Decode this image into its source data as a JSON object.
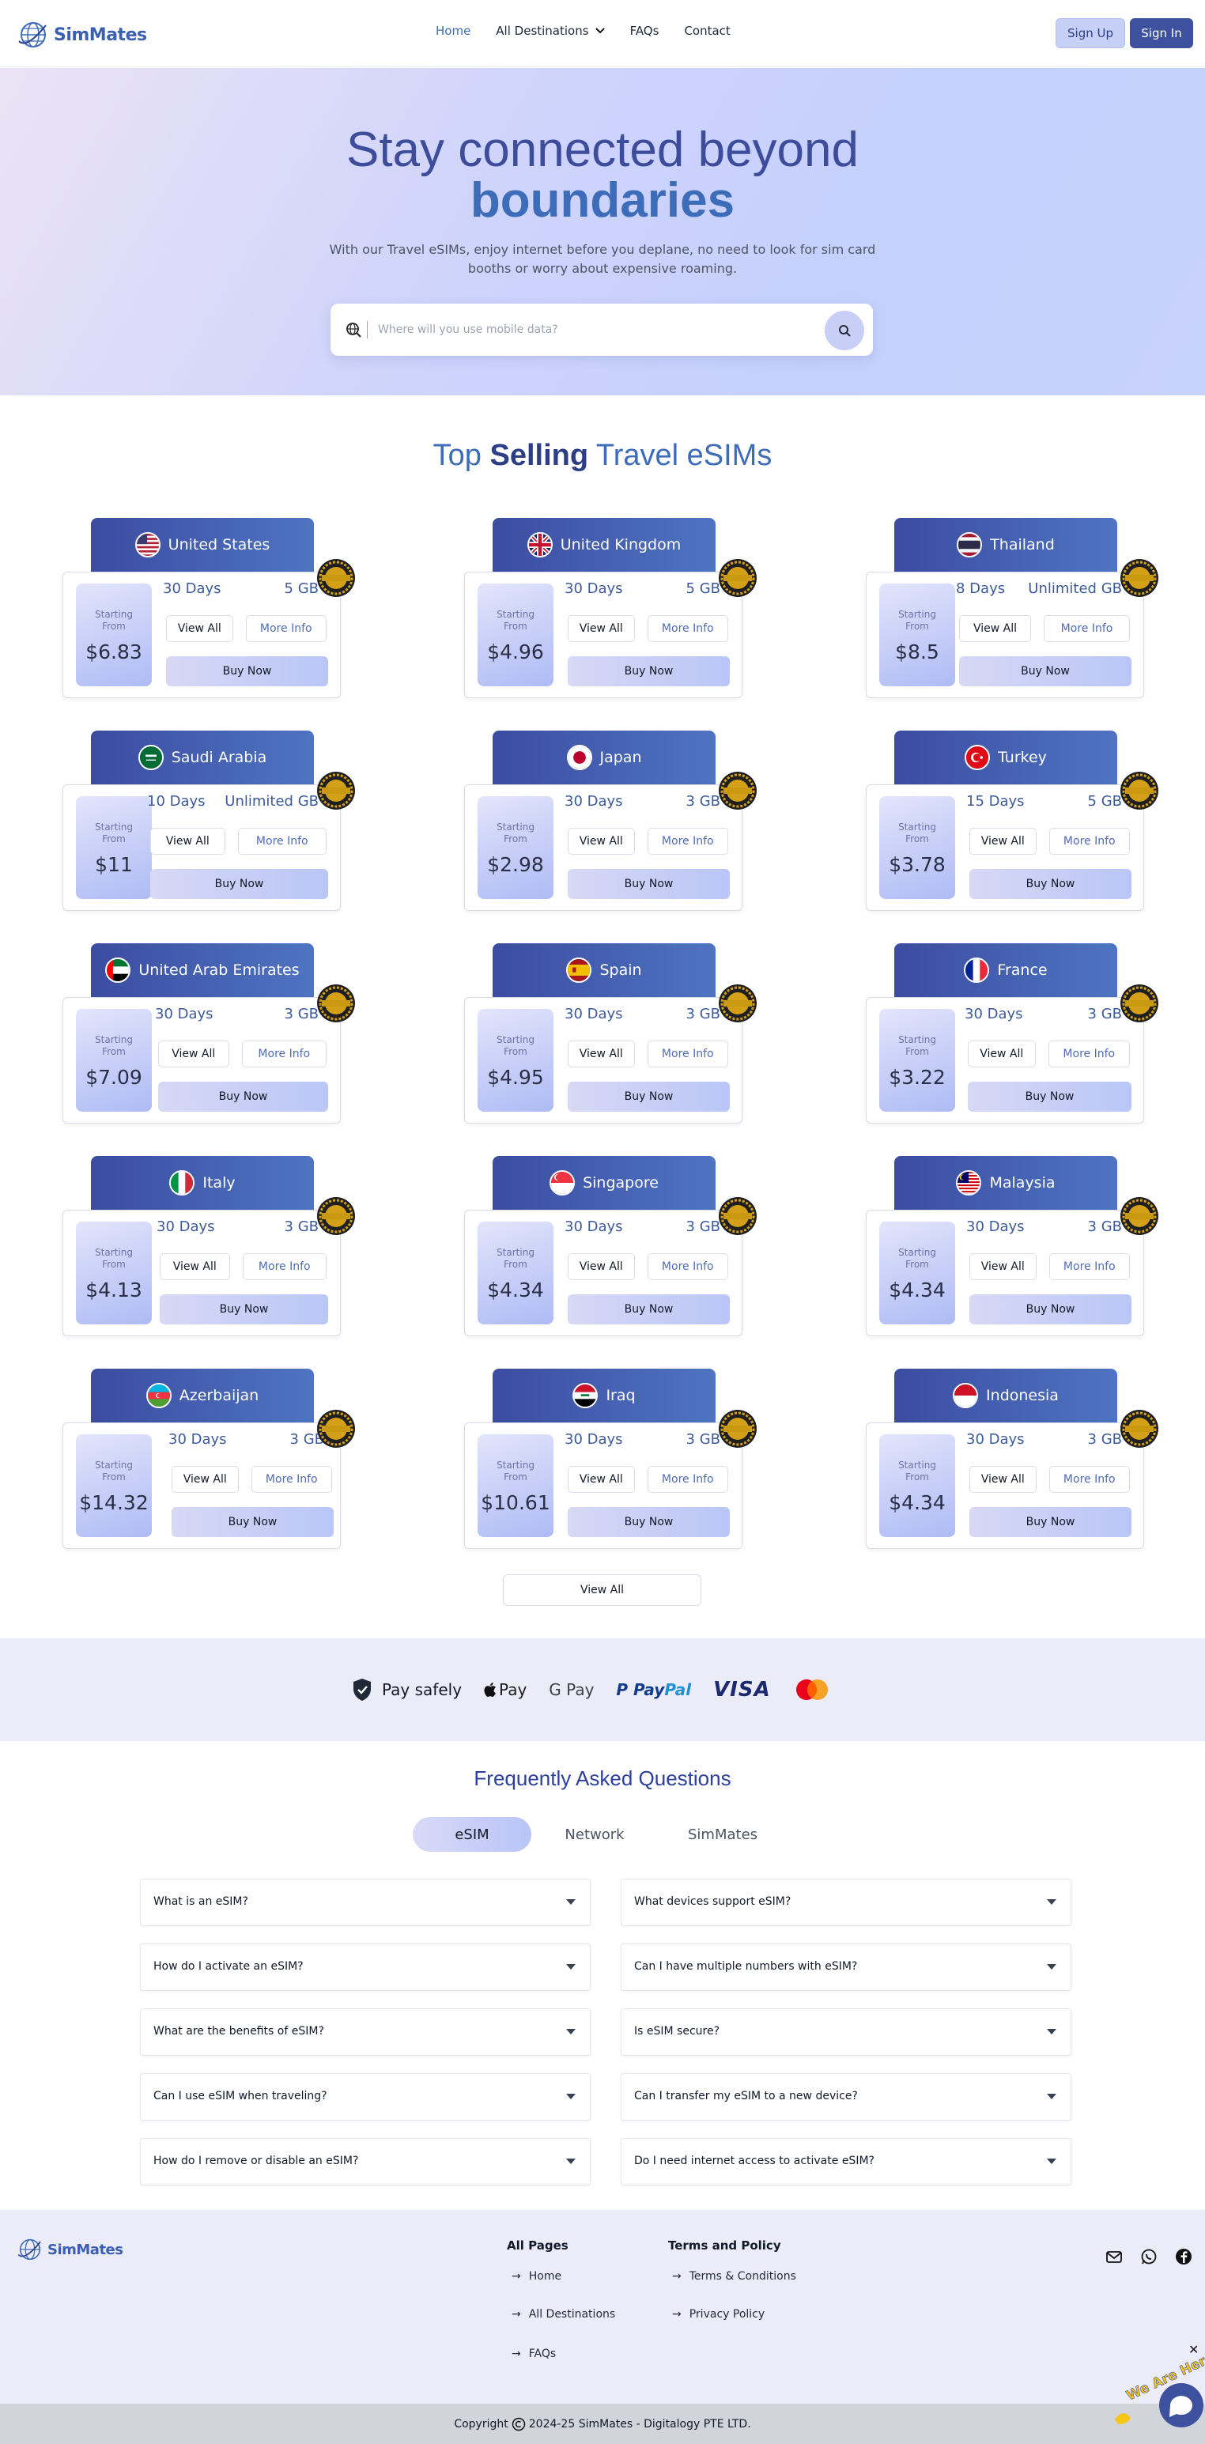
{
  "nav": {
    "logo": "SimMates",
    "links": [
      "Home",
      "All Destinations",
      "FAQs",
      "Contact"
    ],
    "signup": "Sign Up",
    "signin": "Sign In"
  },
  "hero": {
    "title_line1": "Stay connected beyond",
    "title_line2": "boundaries",
    "subtitle": "With our Travel eSIMs, enjoy internet before you deplane, no need to look for sim card booths or worry about expensive roaming.",
    "search_placeholder": "Where will you use mobile data?"
  },
  "section": {
    "title_a": "Top ",
    "title_b": "Selling",
    "title_c": " Travel eSIMs"
  },
  "card_labels": {
    "starting": "Starting",
    "from": "From",
    "view_all": "View All",
    "more_info": "More Info",
    "buy_now": "Buy Now"
  },
  "cards": [
    {
      "country": "United States",
      "price": "$6.83",
      "days": "30 Days",
      "data": "5 GB"
    },
    {
      "country": "United Kingdom",
      "price": "$4.96",
      "days": "30 Days",
      "data": "5 GB"
    },
    {
      "country": "Thailand",
      "price": "$8.5",
      "days": "8 Days",
      "data": "Unlimited GB"
    },
    {
      "country": "Saudi Arabia",
      "price": "$11",
      "days": "10 Days",
      "data": "Unlimited GB"
    },
    {
      "country": "Japan",
      "price": "$2.98",
      "days": "30 Days",
      "data": "3 GB"
    },
    {
      "country": "Turkey",
      "price": "$3.78",
      "days": "15 Days",
      "data": "5 GB"
    },
    {
      "country": "United Arab Emirates",
      "price": "$7.09",
      "days": "30 Days",
      "data": "3 GB"
    },
    {
      "country": "Spain",
      "price": "$4.95",
      "days": "30 Days",
      "data": "3 GB"
    },
    {
      "country": "France",
      "price": "$3.22",
      "days": "30 Days",
      "data": "3 GB"
    },
    {
      "country": "Italy",
      "price": "$4.13",
      "days": "30 Days",
      "data": "3 GB"
    },
    {
      "country": "Singapore",
      "price": "$4.34",
      "days": "30 Days",
      "data": "3 GB"
    },
    {
      "country": "Malaysia",
      "price": "$4.34",
      "days": "30 Days",
      "data": "3 GB"
    },
    {
      "country": "Azerbaijan",
      "price": "$14.32",
      "days": "30 Days",
      "data": "3 GB"
    },
    {
      "country": "Iraq",
      "price": "$10.61",
      "days": "30 Days",
      "data": "3 GB"
    },
    {
      "country": "Indonesia",
      "price": "$4.34",
      "days": "30 Days",
      "data": "3 GB"
    }
  ],
  "view_all": "View All",
  "payments": {
    "label": "Pay safely",
    "apple": "Pay",
    "google": "G Pay",
    "paypal_a": "Pay",
    "paypal_b": "Pal",
    "visa": "VISA"
  },
  "faq": {
    "title": "Frequently Asked Questions",
    "tabs": [
      "eSIM",
      "Network",
      "SimMates"
    ],
    "questions": [
      "What is an eSIM?",
      "What devices support eSIM?",
      "How do I activate an eSIM?",
      "Can I have multiple numbers with eSIM?",
      "What are the benefits of eSIM?",
      "Is eSIM secure?",
      "Can I use eSIM when traveling?",
      "Can I transfer my eSIM to a new device?",
      "How do I remove or disable an eSIM?",
      "Do I need internet access to activate eSIM?"
    ]
  },
  "footer": {
    "logo": "SimMates",
    "col1_title": "All Pages",
    "col1_links": [
      "Home",
      "All Destinations",
      "FAQs"
    ],
    "col2_title": "Terms and Policy",
    "col2_links": [
      "Terms & Conditions",
      "Privacy Policy"
    ],
    "copyright_a": "Copyright",
    "copyright_b": "2024-25 SimMates - Digitalogy PTE LTD.",
    "chat_text": "We Are Here!"
  }
}
